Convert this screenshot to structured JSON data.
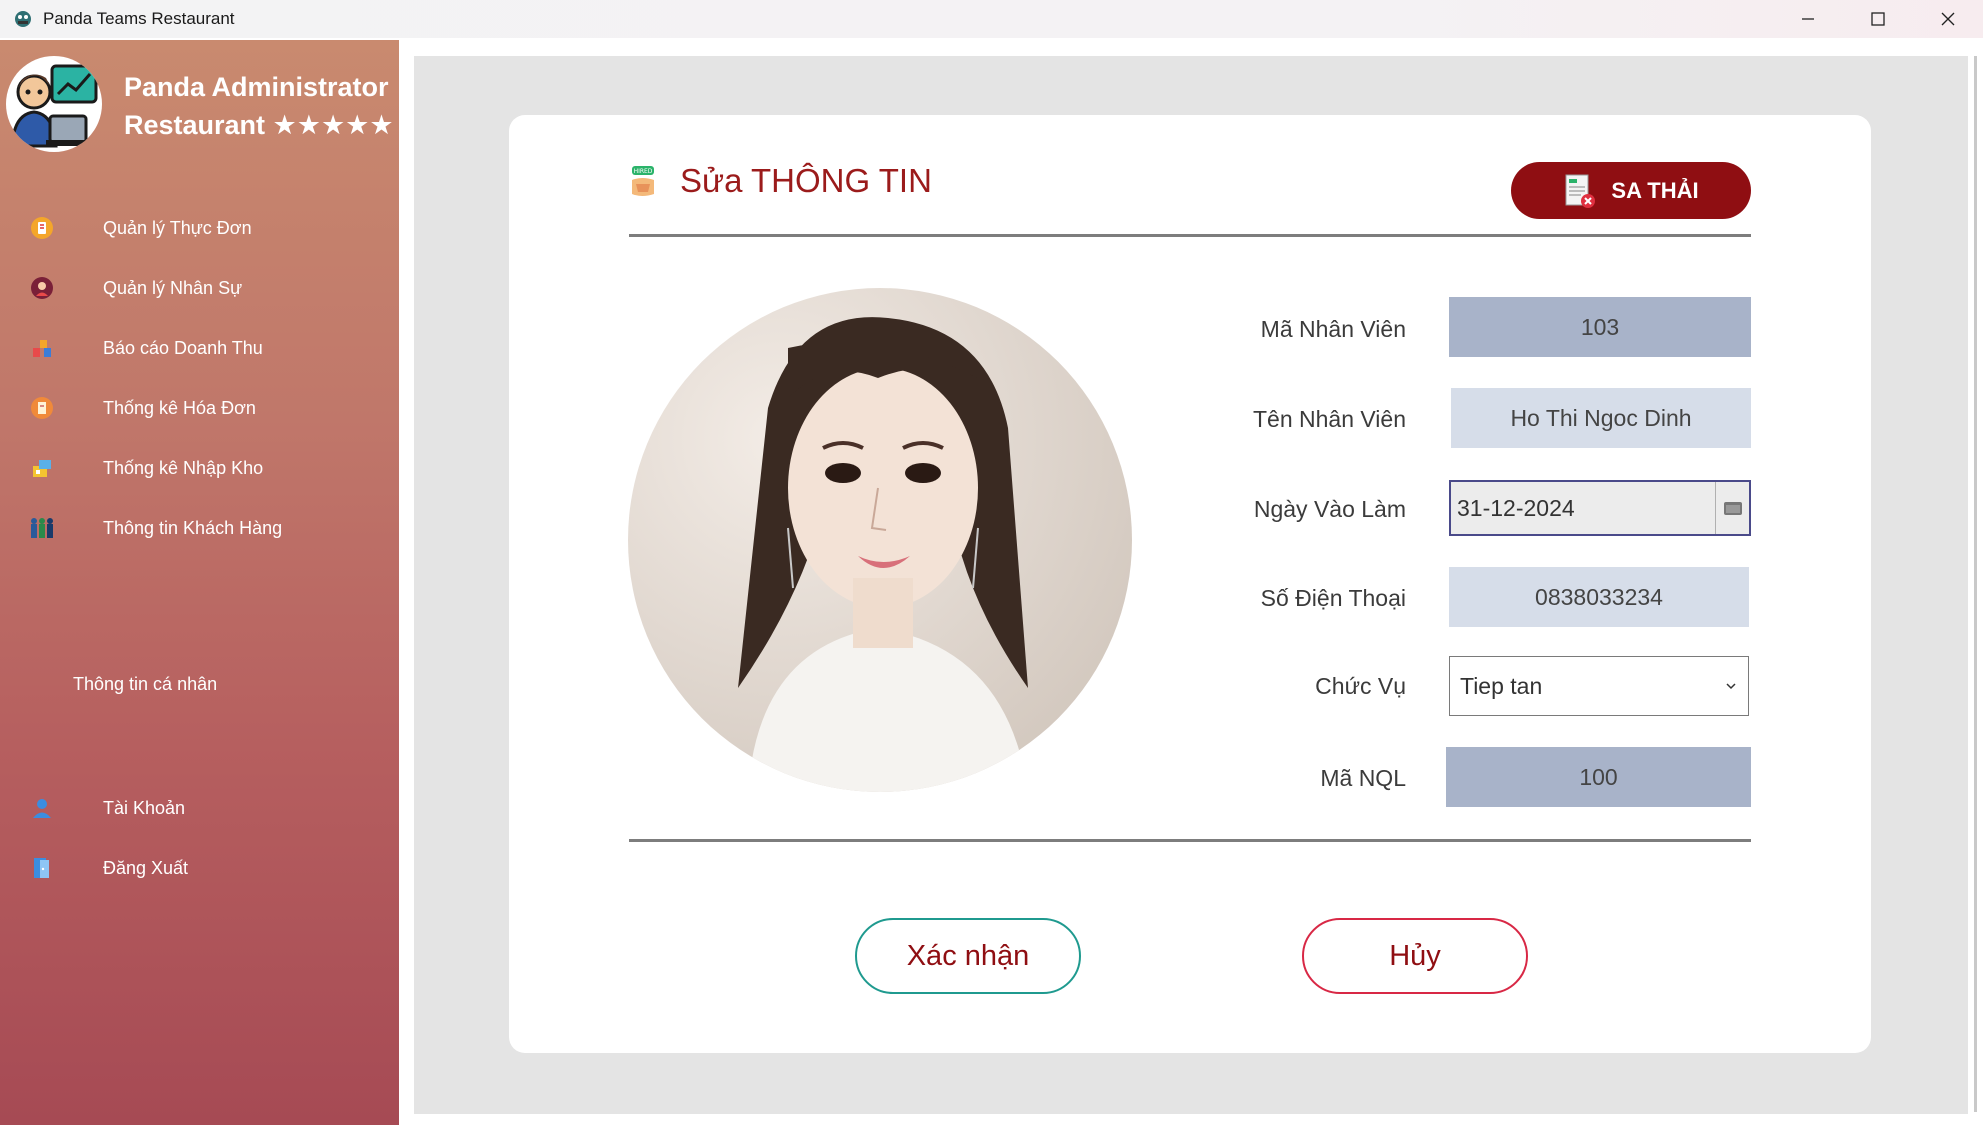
{
  "window": {
    "title": "Panda Teams Restaurant",
    "controls": [
      "minimize-icon",
      "maximize-icon",
      "close-icon"
    ]
  },
  "sidebar": {
    "brand_line1": "Panda Administrator",
    "brand_line2": "Restaurant ★★★★★",
    "items": [
      {
        "label": "Quản lý Thực Đơn",
        "icon": "menu-icon"
      },
      {
        "label": "Quản lý Nhân Sự",
        "icon": "staff-icon"
      },
      {
        "label": "Báo cáo Doanh Thu",
        "icon": "revenue-chart-icon"
      },
      {
        "label": "Thống kê Hóa Đơn",
        "icon": "invoice-icon"
      },
      {
        "label": "Thống kê Nhập Kho",
        "icon": "warehouse-icon"
      },
      {
        "label": "Thông tin Khách Hàng",
        "icon": "customers-icon"
      }
    ],
    "section_label": "Thông tin cá nhân",
    "account_items": [
      {
        "label": "Tài Khoản",
        "icon": "user-icon"
      },
      {
        "label": "Đăng Xuất",
        "icon": "logout-icon"
      }
    ]
  },
  "form": {
    "title": "Sửa THÔNG TIN",
    "fire_button": "SA THẢI",
    "fields": {
      "employee_id": {
        "label": "Mã Nhân Viên",
        "value": "103"
      },
      "employee_name": {
        "label": "Tên Nhân Viên",
        "value": "Ho Thi Ngoc Dinh"
      },
      "start_date": {
        "label": "Ngày Vào Làm",
        "value": "31-12-2024"
      },
      "phone": {
        "label": "Số Điện Thoại",
        "value": "0838033234"
      },
      "position": {
        "label": "Chức Vụ",
        "value": "Tiep tan"
      },
      "manager_id": {
        "label": "Mã NQL",
        "value": "100"
      }
    },
    "confirm_button": "Xác nhận",
    "cancel_button": "Hủy"
  },
  "colors": {
    "accent_red": "#8f0e12",
    "title_red": "#9b1b1b",
    "confirm_border": "#1f9a8f",
    "cancel_border": "#d82845",
    "readonly_field": "#a8b3c9",
    "editable_field": "#d6dde9"
  }
}
